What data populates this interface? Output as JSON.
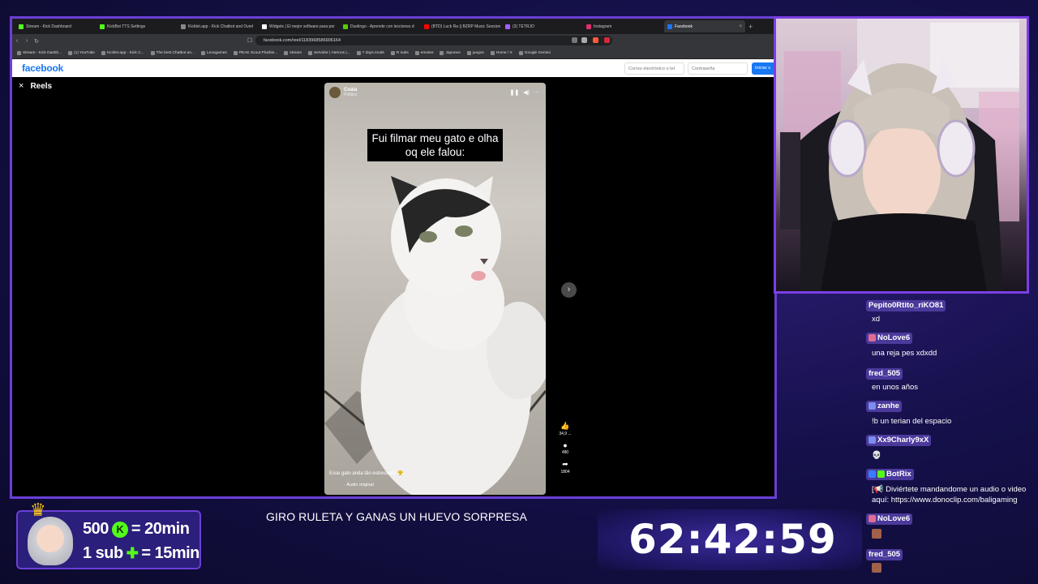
{
  "browser": {
    "tabs": [
      {
        "label": "Stream - Kick Dashboard",
        "color": "#53fc18"
      },
      {
        "label": "KickBot TTS Settings",
        "color": "#53fc18"
      },
      {
        "label": "Kicklet.app - Kick Chatbot and Overl",
        "color": "#888888"
      },
      {
        "label": "Widgets | El mejor software para per",
        "color": "#ffffff"
      },
      {
        "label": "Duolingo - Aprende con lecciones d",
        "color": "#58cc02"
      },
      {
        "label": "(BTD) Luck Ra || BZRP Music Session",
        "color": "#ff0000"
      },
      {
        "label": "(3) TETRJO",
        "color": "#a060ff"
      },
      {
        "label": "Instagram",
        "color": "#e1306c"
      },
      {
        "label": "Facebook",
        "color": "#1877f2"
      }
    ],
    "new_tab": "+",
    "url": "facebook.com/reel/1183968586906164",
    "bookmarks": [
      "Stream - Kick Dashb...",
      "(1) YouTube",
      "Kicklet.app - Kick C...",
      "The best Chatbot an...",
      "Lexogames",
      "PEAK Scout Plushie...",
      "stream",
      "Servidor | Aternos |...",
      "7 days mods",
      "R subs",
      "emotes",
      "Japones",
      "juegos",
      "Home / X",
      "Google Gemini"
    ]
  },
  "facebook": {
    "logo": "facebook",
    "email_placeholder": "Correo electrónico o tel",
    "password_placeholder": "Contraseña",
    "login_label": "Iniciar s",
    "reels_title": "Reels",
    "close_icon": "×"
  },
  "reel": {
    "author": "Coala",
    "visibility": "Público",
    "caption": "Fui filmar meu gato e olha oq ele falou:",
    "description": "Esse gato anda tão estressado 😤",
    "audio": "· Áudio original",
    "likes": "34,9 ...",
    "comments": "480",
    "shares": "1804",
    "next_icon": "›"
  },
  "chat": [
    {
      "user": "Pepito0Rtito_riKO81",
      "badges": [],
      "text": "xd"
    },
    {
      "user": "NoLove6",
      "badges": [
        "#e36b93"
      ],
      "text": "una reja pes xdxdd"
    },
    {
      "user": "fred_505",
      "badges": [],
      "text": "en unos años"
    },
    {
      "user": "zanhe",
      "badges": [
        "#7b8ef0"
      ],
      "text": "!b un terian del espacio"
    },
    {
      "user": "Xx9Charly9xX",
      "badges": [
        "#7b8ef0"
      ],
      "text": "💀"
    },
    {
      "user": "BotRix",
      "badges": [
        "#3b7bff",
        "#53fc18"
      ],
      "text": "[📢 Diviértete mandandome un audio o video aquí: https://www.donoclip.com/baligaming"
    },
    {
      "user": "NoLove6",
      "badges": [
        "#e36b93"
      ],
      "text": ""
    },
    {
      "user": "fred_505",
      "badges": [],
      "text": ""
    }
  ],
  "overlay": {
    "sub_line1": "500",
    "sub_line1_value": "= 20min",
    "sub_line2": "1 sub",
    "sub_line2_value": "= 15min",
    "marquee": "GIRO RULETA Y GANAS UN HUEVO SORPRESA",
    "timer": "62:42:59"
  },
  "colors": {
    "frame_border": "#6b3fd6",
    "kick_green": "#53fc18",
    "facebook_blue": "#1877f2",
    "chat_name_bg": "#4b3a9c"
  }
}
